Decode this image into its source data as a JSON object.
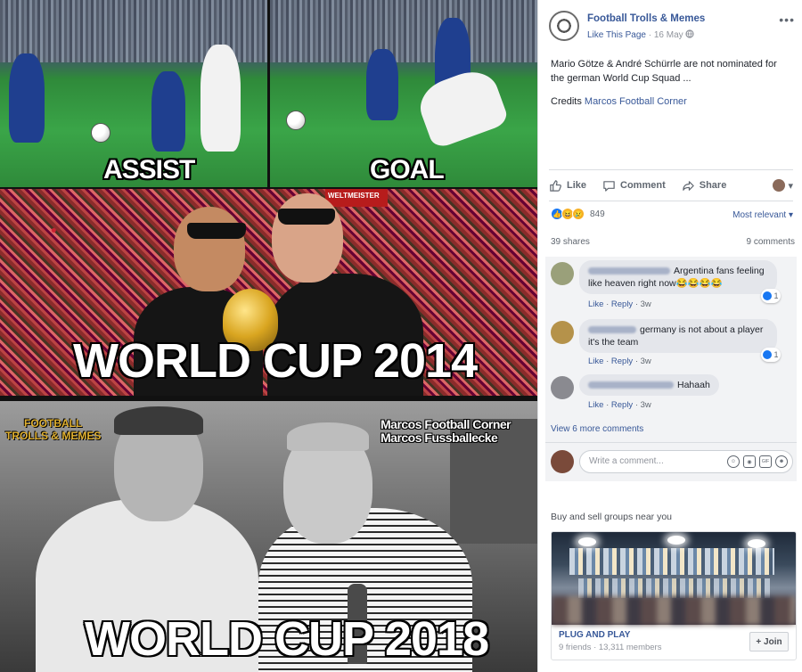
{
  "meme": {
    "captions": {
      "assist": "ASSIST",
      "goal": "GOAL",
      "wc2014": "WORLD CUP 2014",
      "wc2018": "WORLD CUP 2018"
    },
    "watermark_credit": [
      "Marcos Football Corner",
      "Marcos Fussballecke"
    ],
    "logo_text": [
      "FOOTBALL",
      "TROLLS & MEMES"
    ],
    "banner_text": "WELTMEISTER"
  },
  "post": {
    "page_name": "Football Trolls & Memes",
    "like_page_label": "Like This Page",
    "date": "16 May",
    "text": "Mario Götze & André Schürrle are not nominated for the german World Cup Squad ...",
    "credits_label": "Credits",
    "credits_link": "Marcos Football Corner",
    "more_icon": "more-dots-icon"
  },
  "actions": {
    "like": "Like",
    "comment": "Comment",
    "share": "Share"
  },
  "reactions": {
    "count": "849",
    "sort_label": "Most relevant"
  },
  "stats": {
    "shares": "39 shares",
    "comments": "9 comments"
  },
  "comments": [
    {
      "text": "Argentina fans feeling like heaven right now😂😂😂😂",
      "like_label": "Like",
      "reply_label": "Reply",
      "time": "3w",
      "likes": "1"
    },
    {
      "text": "germany is not about a player it's the team",
      "like_label": "Like",
      "reply_label": "Reply",
      "time": "3w",
      "likes": "1"
    },
    {
      "text": "Hahaah",
      "like_label": "Like",
      "reply_label": "Reply",
      "time": "3w"
    }
  ],
  "view_more": "View 6 more comments",
  "write_comment": {
    "placeholder": "Write a comment..."
  },
  "groups": {
    "title": "Buy and sell groups near you",
    "card": {
      "name": "PLUG AND PLAY",
      "meta": "9 friends · 13,311 members",
      "join_label": "+ Join"
    }
  },
  "colors": {
    "link": "#385898",
    "like_blue": "#1877f2",
    "muted": "#606770"
  }
}
